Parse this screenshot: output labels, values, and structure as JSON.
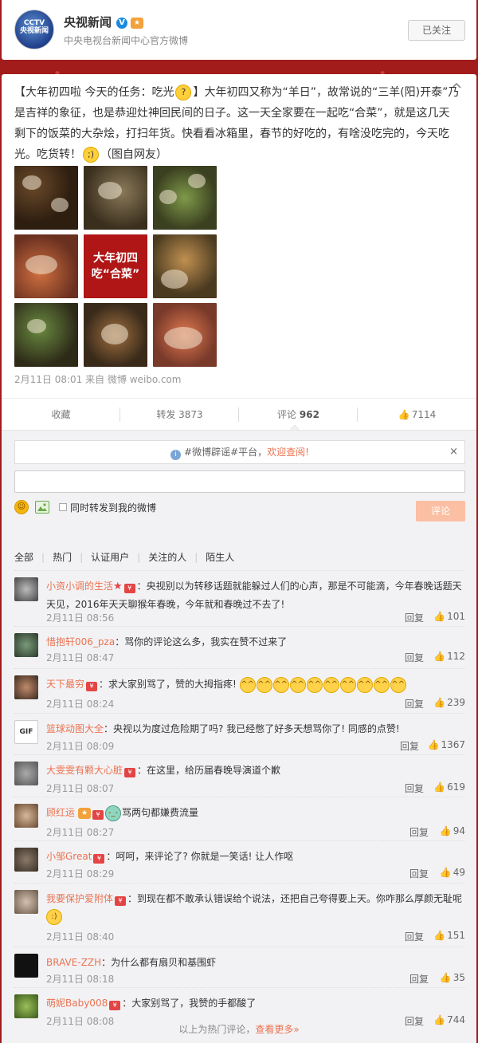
{
  "header": {
    "avatar_text": "CCTV\n央视新闻",
    "name": "央视新闻",
    "verified": "V",
    "description": "中央电视台新闻中心官方微博",
    "follow_button": "已关注"
  },
  "post": {
    "text_part1": "【大年初四啦 今天的任务：吃光",
    "text_part2": "】大年初四又称为“羊日”，故常说的“三羊(阳)开泰”乃是吉祥的象征，也是恭迎灶神回民间的日子。这一天全家要在一起吃“合菜”，就是这几天剩下的饭菜的大杂烩，打扫年货。快看看冰箱里，春节的好吃的，有啥没吃完的，今天吃光。吃货转！",
    "text_part3": "（图自网友）",
    "center_image_text": "大年初四\n吃“合菜”",
    "timestamp": "2月11日 08:01 来自 微博 weibo.com",
    "collapse_icon": "chevron-up-icon"
  },
  "actions": {
    "favorite": "收藏",
    "repost": "转发 3873",
    "comment_label": "评论",
    "comment_count": "962",
    "like": "7114"
  },
  "comment_area": {
    "notice_prefix": "#微博辟谣#平台，",
    "notice_link": "欢迎查阅!",
    "close": "×",
    "input_value": "",
    "repost_checkbox_label": "同时转发到我的微博",
    "send_button": "评论",
    "filters": [
      "全部",
      "热门",
      "认证用户",
      "关注的人",
      "陌生人"
    ],
    "footer_text": "以上为热门评论，",
    "footer_link": "查看更多»"
  },
  "comments": [
    {
      "user": "小资小调的生活",
      "text": "：央视别以为转移话题就能躲过人们的心声，那是不可能滴，今年春晚话题天天见，2016年天天聊猴年春晚，今年就和春晚过不去了!",
      "time": "2月11日 08:56",
      "reply": "回复",
      "likes": "101"
    },
    {
      "user": "惜抱轩006_pza",
      "text": "：骂你的评论这么多，我实在赞不过来了",
      "time": "2月11日 08:47",
      "reply": "回复",
      "likes": "112"
    },
    {
      "user": "天下最穷",
      "text": "：求大家别骂了，赞的大拇指疼!",
      "time": "2月11日 08:24",
      "reply": "回复",
      "likes": "239"
    },
    {
      "user": "篮球动图大全",
      "text": "：央视以为度过危险期了吗? 我已经憋了好多天想骂你了! 同感的点赞!",
      "time": "2月11日 08:09",
      "reply": "回复",
      "likes": "1367"
    },
    {
      "user": "大雯雯有颗大心脏",
      "text": "：在这里，给历届春晚导演道个歉",
      "time": "2月11日 08:07",
      "reply": "回复",
      "likes": "619"
    },
    {
      "user": "顾红运",
      "text": "骂两句都嫌费流量",
      "time": "2月11日 08:27",
      "reply": "回复",
      "likes": "94"
    },
    {
      "user": "小邹Great",
      "text": "：呵呵，来评论了? 你就是一笑话! 让人作呕",
      "time": "2月11日 08:29",
      "reply": "回复",
      "likes": "49"
    },
    {
      "user": "我要保护爱附体",
      "text": "：到现在都不敢承认错误给个说法，还把自己夸得要上天。你咋那么厚颜无耻呢",
      "time": "2月11日 08:40",
      "reply": "回复",
      "likes": "151"
    },
    {
      "user": "BRAVE-ZZH",
      "text": "：为什么都有扇贝和基围虾",
      "time": "2月11日 08:18",
      "reply": "回复",
      "likes": "35"
    },
    {
      "user": "萌妮Baby008",
      "text": "：大家别骂了，我赞的手都酸了",
      "time": "2月11日 08:08",
      "reply": "回复",
      "likes": "744"
    }
  ]
}
